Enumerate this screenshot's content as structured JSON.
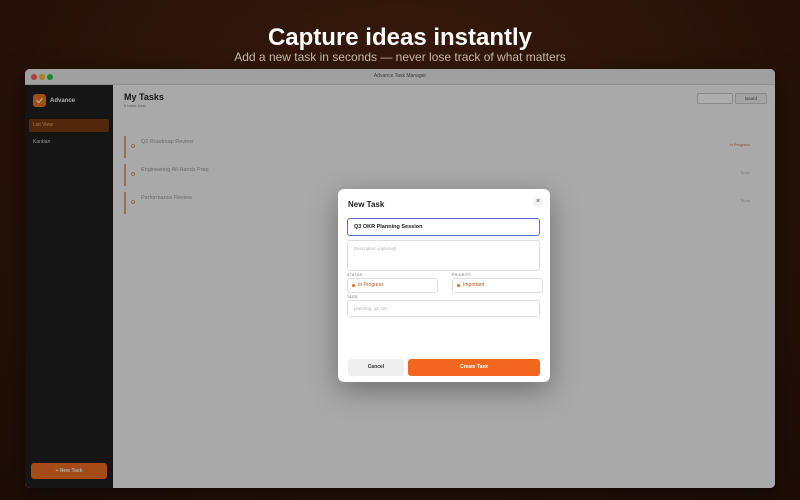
{
  "hero": {
    "title": "Capture ideas instantly",
    "subtitle": "Add a new task in seconds — never lose track of what matters"
  },
  "window": {
    "title": "Advance Task Manager"
  },
  "sidebar": {
    "brand": "Advance",
    "items": [
      {
        "label": "List View",
        "active": true
      },
      {
        "label": "Kanban",
        "active": false
      }
    ],
    "new_task_label": "+ New Task"
  },
  "main": {
    "title": "My Tasks",
    "count": "6 tasks total",
    "board_label": "Board",
    "tasks": [
      {
        "title": "Q2 Roadmap Review",
        "status": "In Progress"
      },
      {
        "title": "Engineering All-Hands Prep",
        "status": "To do"
      },
      {
        "title": "Performance Review",
        "status": "To do"
      }
    ]
  },
  "modal": {
    "title": "New Task",
    "close_icon": "×",
    "title_value": "Q3 OKR Planning Session",
    "description_placeholder": "Description (optional)",
    "status_label": "STATUS",
    "status_value": "In Progress",
    "priority_label": "PRIORITY",
    "priority_value": "Important",
    "tags_label": "TAGS",
    "tags_placeholder": "planning, q3, okr",
    "cancel_label": "Cancel",
    "create_label": "Create Task"
  },
  "colors": {
    "accent": "#f2661f",
    "sidebar": "#1f1f1f",
    "focus": "#5a70c8"
  },
  "icons": [
    "check-icon",
    "close-icon",
    "dot-icon"
  ]
}
